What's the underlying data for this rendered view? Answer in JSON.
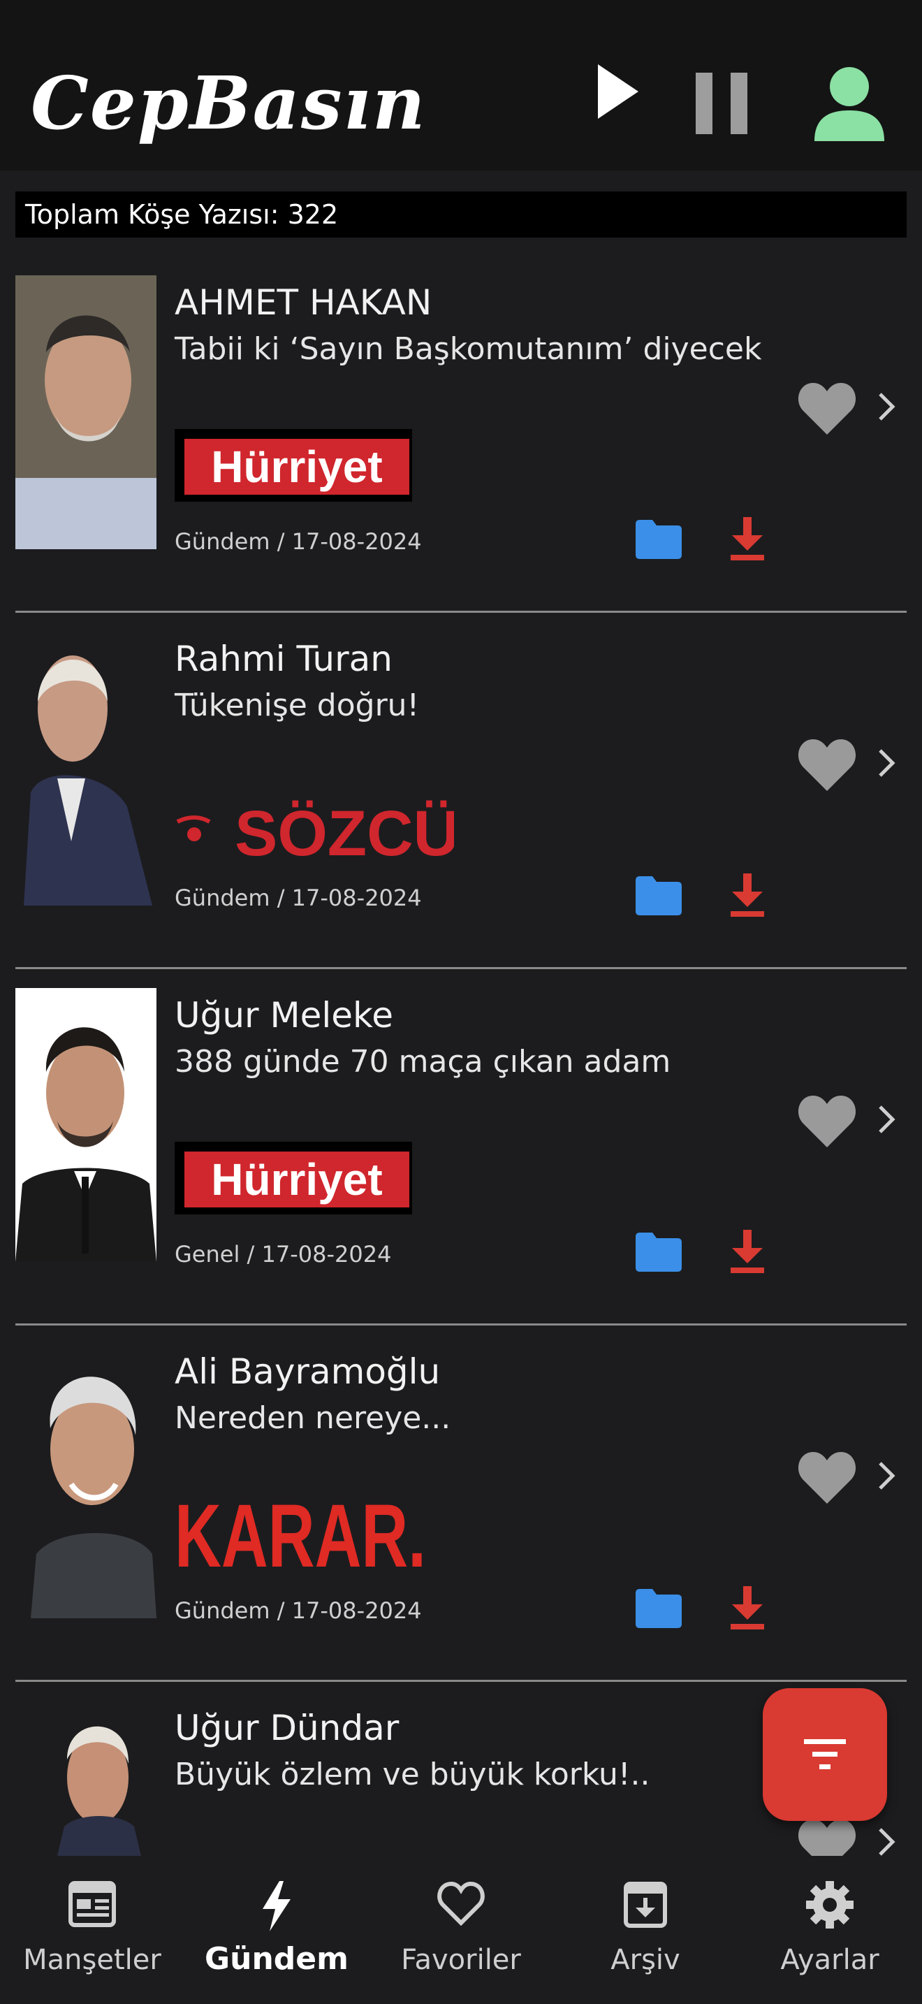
{
  "app": {
    "logo": "CepBasın",
    "total_label": "Toplam Köşe Yazısı: 322"
  },
  "colors": {
    "accent_red": "#d93a32",
    "folder_blue": "#3b8fe8",
    "profile_green": "#8be0a4",
    "heart_gray": "#9a9a9a"
  },
  "articles": [
    {
      "author": "AHMET HAKAN",
      "title": "Tabii ki ‘Sayın Başkomutanım’ diyecek",
      "source": "Hürriyet",
      "meta": "Gündem / 17-08-2024"
    },
    {
      "author": "Rahmi Turan",
      "title": "Tükenişe doğru!",
      "source": "SÖZCÜ",
      "meta": "Gündem / 17-08-2024"
    },
    {
      "author": "Uğur Meleke",
      "title": "388 günde 70 maça çıkan adam",
      "source": "Hürriyet",
      "meta": "Genel / 17-08-2024"
    },
    {
      "author": "Ali Bayramoğlu",
      "title": "Nereden nereye...",
      "source": "KARAR.",
      "meta": "Gündem / 17-08-2024"
    },
    {
      "author": "Uğur Dündar",
      "title": "Büyük özlem ve büyük korku!..",
      "source": "",
      "meta": ""
    }
  ],
  "tabs": [
    {
      "label": "Manşetler",
      "icon": "newspaper-icon"
    },
    {
      "label": "Gündem",
      "icon": "bolt-icon"
    },
    {
      "label": "Favoriler",
      "icon": "heart-outline-icon"
    },
    {
      "label": "Arşiv",
      "icon": "archive-icon"
    },
    {
      "label": "Ayarlar",
      "icon": "gear-icon"
    }
  ]
}
